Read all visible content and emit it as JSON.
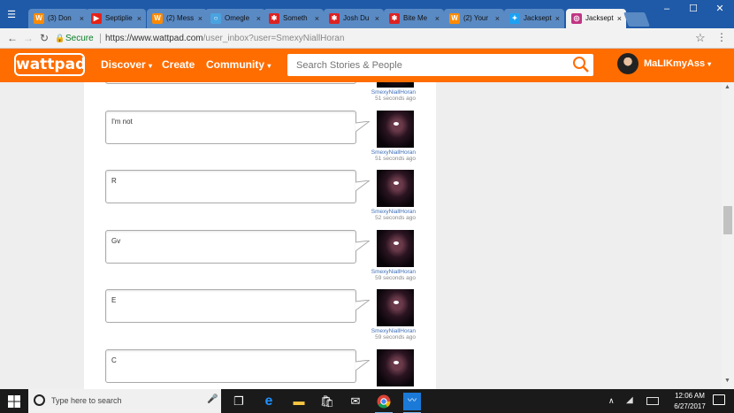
{
  "tabs": [
    {
      "label": "(3) Don",
      "icon": "wattpad-icon",
      "color": "#ff8a00"
    },
    {
      "label": "Septiplie",
      "icon": "youtube-icon",
      "color": "#e62117"
    },
    {
      "label": "(2) Mess",
      "icon": "wattpad-icon",
      "color": "#ff8a00"
    },
    {
      "label": "Omegle",
      "icon": "omegle-icon",
      "color": "#4aa3df"
    },
    {
      "label": "Someth",
      "icon": "quotev-icon",
      "color": "#d22"
    },
    {
      "label": "Josh Du",
      "icon": "quotev-icon",
      "color": "#d22"
    },
    {
      "label": "Bite Me",
      "icon": "quotev-icon",
      "color": "#d22"
    },
    {
      "label": "(2) Your",
      "icon": "wattpad-icon",
      "color": "#ff8a00"
    },
    {
      "label": "Jacksept",
      "icon": "twitter-icon",
      "color": "#1da1f2"
    },
    {
      "label": "Jacksept",
      "icon": "instagram-icon",
      "color": "#c13584"
    }
  ],
  "address": {
    "secure_label": "Secure",
    "url_domain": "https://www.wattpad.com",
    "url_path": "/user_inbox?user=SmexyNiallHoran"
  },
  "header": {
    "logo": "wattpad",
    "nav": [
      "Discover",
      "Create",
      "Community"
    ],
    "search_placeholder": "Search Stories & People",
    "username": "MaLIKmyAss"
  },
  "messages": [
    {
      "text": "",
      "user": "SmexyNiallHoran",
      "time": "51 seconds ago"
    },
    {
      "text": "I'm not",
      "user": "SmexyNiallHoran",
      "time": "51 seconds ago"
    },
    {
      "text": "R",
      "user": "SmexyNiallHoran",
      "time": "52 seconds ago"
    },
    {
      "text": "Gv",
      "user": "SmexyNiallHoran",
      "time": "59 seconds ago"
    },
    {
      "text": "E",
      "user": "SmexyNiallHoran",
      "time": "59 seconds ago"
    },
    {
      "text": "C",
      "user": "",
      "time": ""
    }
  ],
  "taskbar": {
    "search_placeholder": "Type here to search",
    "time": "12:06 AM",
    "date": "6/27/2017"
  },
  "colors": {
    "wattpad_orange": "#ff6d00",
    "tabstrip_blue": "#1f5aa8",
    "link_blue": "#3d6fb8"
  }
}
